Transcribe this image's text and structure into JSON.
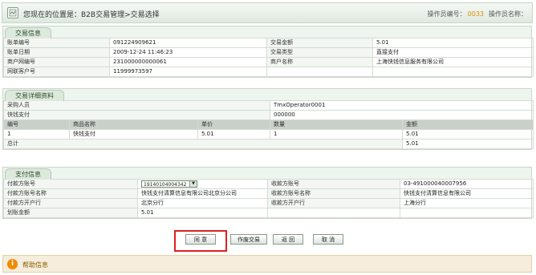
{
  "header": {
    "location": "您现在的位置是：B2B交易管理>交易选择",
    "operator_id_label": "操作员编号：",
    "operator_id": "0033",
    "operator_name_label": "操作员名称："
  },
  "trade_info": {
    "title": "交易信息",
    "rows": [
      [
        "账单编号",
        "091224909621",
        "交易金额",
        "5.01"
      ],
      [
        "账单日期",
        "2009-12-24 11:46:23",
        "交易类型",
        "直接支付"
      ],
      [
        "商户网编号",
        "231000000000061",
        "商户名称",
        "上海快钱信息服务有限公司"
      ],
      [
        "网联客户号",
        "11999973597",
        "",
        ""
      ]
    ]
  },
  "trade_detail": {
    "title": "交易详细资料",
    "buyer_label": "采购人员",
    "buyer_value": "TmxOperator0001",
    "pay_label": "快钱支付",
    "pay_value": "000000",
    "headers": [
      "编号",
      "商品名称",
      "单价",
      "数量",
      "金额"
    ],
    "items": [
      [
        "1",
        "快钱支付",
        "5.01",
        "1",
        "5.01"
      ]
    ],
    "total_label": "总计",
    "total_value": "5.01"
  },
  "payment": {
    "title": "支付信息",
    "payer_account_label": "付款方账号",
    "payer_account_value": "19140104004342",
    "payee_account_label": "收款方账号",
    "payee_account_value": "03-491000040007956",
    "payer_name_label": "付款方账号名称",
    "payer_name_value": "快钱支付清算信息有限公司北京分公司",
    "payee_name_label": "收款方账号名称",
    "payee_name_value": "快钱支付清算信息有限公司",
    "payer_bank_label": "付款方开户行",
    "payer_bank_value": "北京分行",
    "payee_bank_label": "收款方开户行",
    "payee_bank_value": "上海分行",
    "amount_label": "划账金额",
    "amount_value": "5.01"
  },
  "buttons": {
    "agree": "同 意",
    "void": "作废交易",
    "back": "返 回",
    "cancel": "取 消"
  },
  "help": {
    "title": "帮助信息"
  }
}
